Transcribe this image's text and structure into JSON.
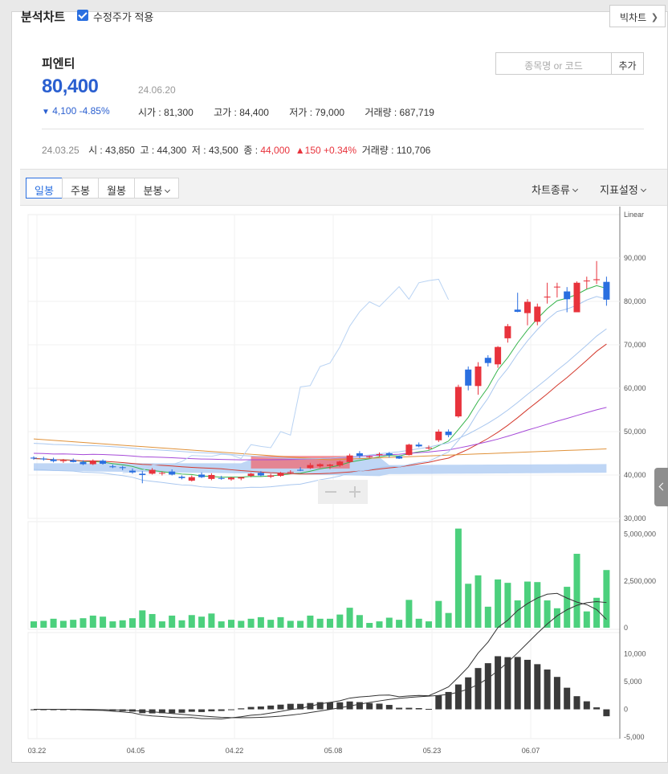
{
  "header": {
    "title": "분석차트",
    "adjusted_label": "수정주가 적용",
    "big_chart_label": "빅차트"
  },
  "stock": {
    "name": "피엔티",
    "price": "80,400",
    "date": "24.06.20",
    "change_amount": "4,100",
    "change_pct": "-4.85%",
    "open": "시가 : 81,300",
    "high": "고가 : 84,400",
    "low": "저가 : 79,000",
    "volume": "거래량 : 687,719"
  },
  "search": {
    "placeholder": "종목명 or 코드",
    "add_label": "추가"
  },
  "history": {
    "date": "24.03.25",
    "open": "시 : 43,850",
    "high": "고 : 44,300",
    "low": "저 : 43,500",
    "close_label": "종 : ",
    "close": "44,000",
    "change": "150 +0.34%",
    "volume": "거래량 : 110,706"
  },
  "tabs": [
    "일봉",
    "주봉",
    "월봉",
    "분봉"
  ],
  "menus": {
    "chart_type": "차트종류",
    "indicators": "지표설정"
  },
  "colors": {
    "up": "#e8333c",
    "down": "#2a6fe0",
    "volume": "#4cd07d",
    "accent": "#2a6fe0"
  },
  "chart_data": [
    {
      "type": "candlestick",
      "scale_label": "Linear",
      "y_ticks": [
        "90,000",
        "80,000",
        "70,000",
        "60,000",
        "50,000",
        "40,000",
        "30,000"
      ],
      "ylim": [
        30000,
        90000
      ],
      "x_ticks": [
        "03.22",
        "04.05",
        "04.22",
        "05.08",
        "05.23",
        "06.07"
      ],
      "candles": [
        [
          44000,
          44300,
          43500,
          43800
        ],
        [
          43800,
          44200,
          43300,
          43600
        ],
        [
          43600,
          44000,
          42900,
          43200
        ],
        [
          43200,
          43700,
          42800,
          43400
        ],
        [
          43400,
          43800,
          42900,
          43000
        ],
        [
          43000,
          43400,
          42300,
          42500
        ],
        [
          42500,
          43600,
          42300,
          43300
        ],
        [
          43300,
          43600,
          42400,
          42600
        ],
        [
          42000,
          42400,
          41600,
          41800
        ],
        [
          41800,
          42100,
          41100,
          41600
        ],
        [
          41000,
          41500,
          40300,
          40600
        ],
        [
          40300,
          40900,
          38100,
          40000
        ],
        [
          40300,
          41600,
          40100,
          41200
        ],
        [
          40400,
          40800,
          39900,
          40500
        ],
        [
          40800,
          41300,
          39900,
          40100
        ],
        [
          39600,
          39900,
          39000,
          39300
        ],
        [
          38700,
          39900,
          38500,
          39500
        ],
        [
          40100,
          40600,
          39300,
          39500
        ],
        [
          39100,
          40400,
          38800,
          40000
        ],
        [
          39300,
          39800,
          38900,
          39200
        ],
        [
          39000,
          39600,
          38700,
          39400
        ],
        [
          39200,
          39600,
          38800,
          39500
        ],
        [
          39800,
          40500,
          39500,
          40300
        ],
        [
          40500,
          40900,
          39700,
          39900
        ],
        [
          39600,
          40300,
          39300,
          39900
        ],
        [
          39800,
          40700,
          39600,
          40500
        ],
        [
          40500,
          41100,
          40200,
          40700
        ],
        [
          41200,
          41800,
          40900,
          41000
        ],
        [
          41600,
          42800,
          41400,
          42300
        ],
        [
          42000,
          42700,
          41700,
          42500
        ],
        [
          42100,
          42600,
          41400,
          42400
        ],
        [
          42200,
          43300,
          41900,
          43100
        ],
        [
          43000,
          44900,
          42800,
          44500
        ],
        [
          45000,
          45500,
          43900,
          44400
        ],
        [
          44200,
          44500,
          43900,
          44300
        ],
        [
          44800,
          45200,
          44200,
          44800
        ],
        [
          45000,
          45300,
          44000,
          44600
        ],
        [
          44300,
          44500,
          43700,
          43800
        ],
        [
          44600,
          47200,
          44500,
          47000
        ],
        [
          47000,
          47500,
          46400,
          46600
        ],
        [
          46300,
          46800,
          45800,
          46300
        ],
        [
          48000,
          50500,
          47600,
          50000
        ],
        [
          50000,
          50500,
          48700,
          49200
        ],
        [
          53500,
          60800,
          53200,
          60300
        ],
        [
          64300,
          65000,
          59500,
          60600
        ],
        [
          60500,
          66000,
          58500,
          65000
        ],
        [
          67000,
          67600,
          65000,
          65800
        ],
        [
          65500,
          69700,
          64700,
          69500
        ],
        [
          71500,
          74800,
          70500,
          74300
        ],
        [
          78100,
          82000,
          77500,
          77600
        ],
        [
          77300,
          80500,
          74500,
          79900
        ],
        [
          75300,
          79500,
          74500,
          78800
        ],
        [
          80900,
          84300,
          79500,
          81100
        ],
        [
          83300,
          84300,
          80900,
          83400
        ],
        [
          82300,
          83300,
          77500,
          80500
        ],
        [
          77500,
          84600,
          77500,
          84300
        ],
        [
          84700,
          85700,
          82900,
          84800
        ],
        [
          84900,
          89300,
          84000,
          85100
        ],
        [
          84500,
          85700,
          79000,
          80400
        ]
      ]
    },
    {
      "type": "bar",
      "y_ticks": [
        "5,000,000",
        "2,500,000",
        "0"
      ],
      "ylim": [
        0,
        5500000
      ]
    },
    {
      "type": "line",
      "y_ticks": [
        "10,000",
        "5,000",
        "0",
        "-5,000"
      ],
      "ylim": [
        -5000,
        13000
      ]
    }
  ]
}
